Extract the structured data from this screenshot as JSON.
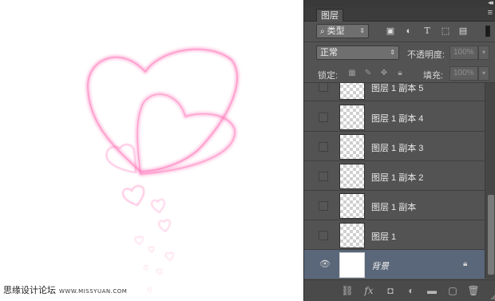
{
  "watermark": {
    "text": "思缘设计论坛",
    "url": "WWW.MISSYUAN.COM"
  },
  "panel": {
    "tab": "图层",
    "filter": {
      "label": "类型"
    },
    "blend": {
      "mode": "正常",
      "opacity_label": "不透明度:",
      "opacity_value": "100%"
    },
    "lock": {
      "label": "锁定:",
      "fill_label": "填充:",
      "fill_value": "100%"
    },
    "layers": [
      {
        "name": "图层 1 副本 5",
        "visible": false,
        "selected": false
      },
      {
        "name": "图层 1 副本 4",
        "visible": false,
        "selected": false
      },
      {
        "name": "图层 1 副本 3",
        "visible": false,
        "selected": false
      },
      {
        "name": "图层 1 副本 2",
        "visible": false,
        "selected": false
      },
      {
        "name": "图层 1 副本",
        "visible": false,
        "selected": false
      },
      {
        "name": "图层 1",
        "visible": false,
        "selected": false
      },
      {
        "name": "背景",
        "visible": true,
        "selected": true,
        "locked": true
      }
    ]
  },
  "colors": {
    "heart_pink": "#ff74b8",
    "panel_bg": "#535353",
    "selected_row": "#5a677a"
  }
}
